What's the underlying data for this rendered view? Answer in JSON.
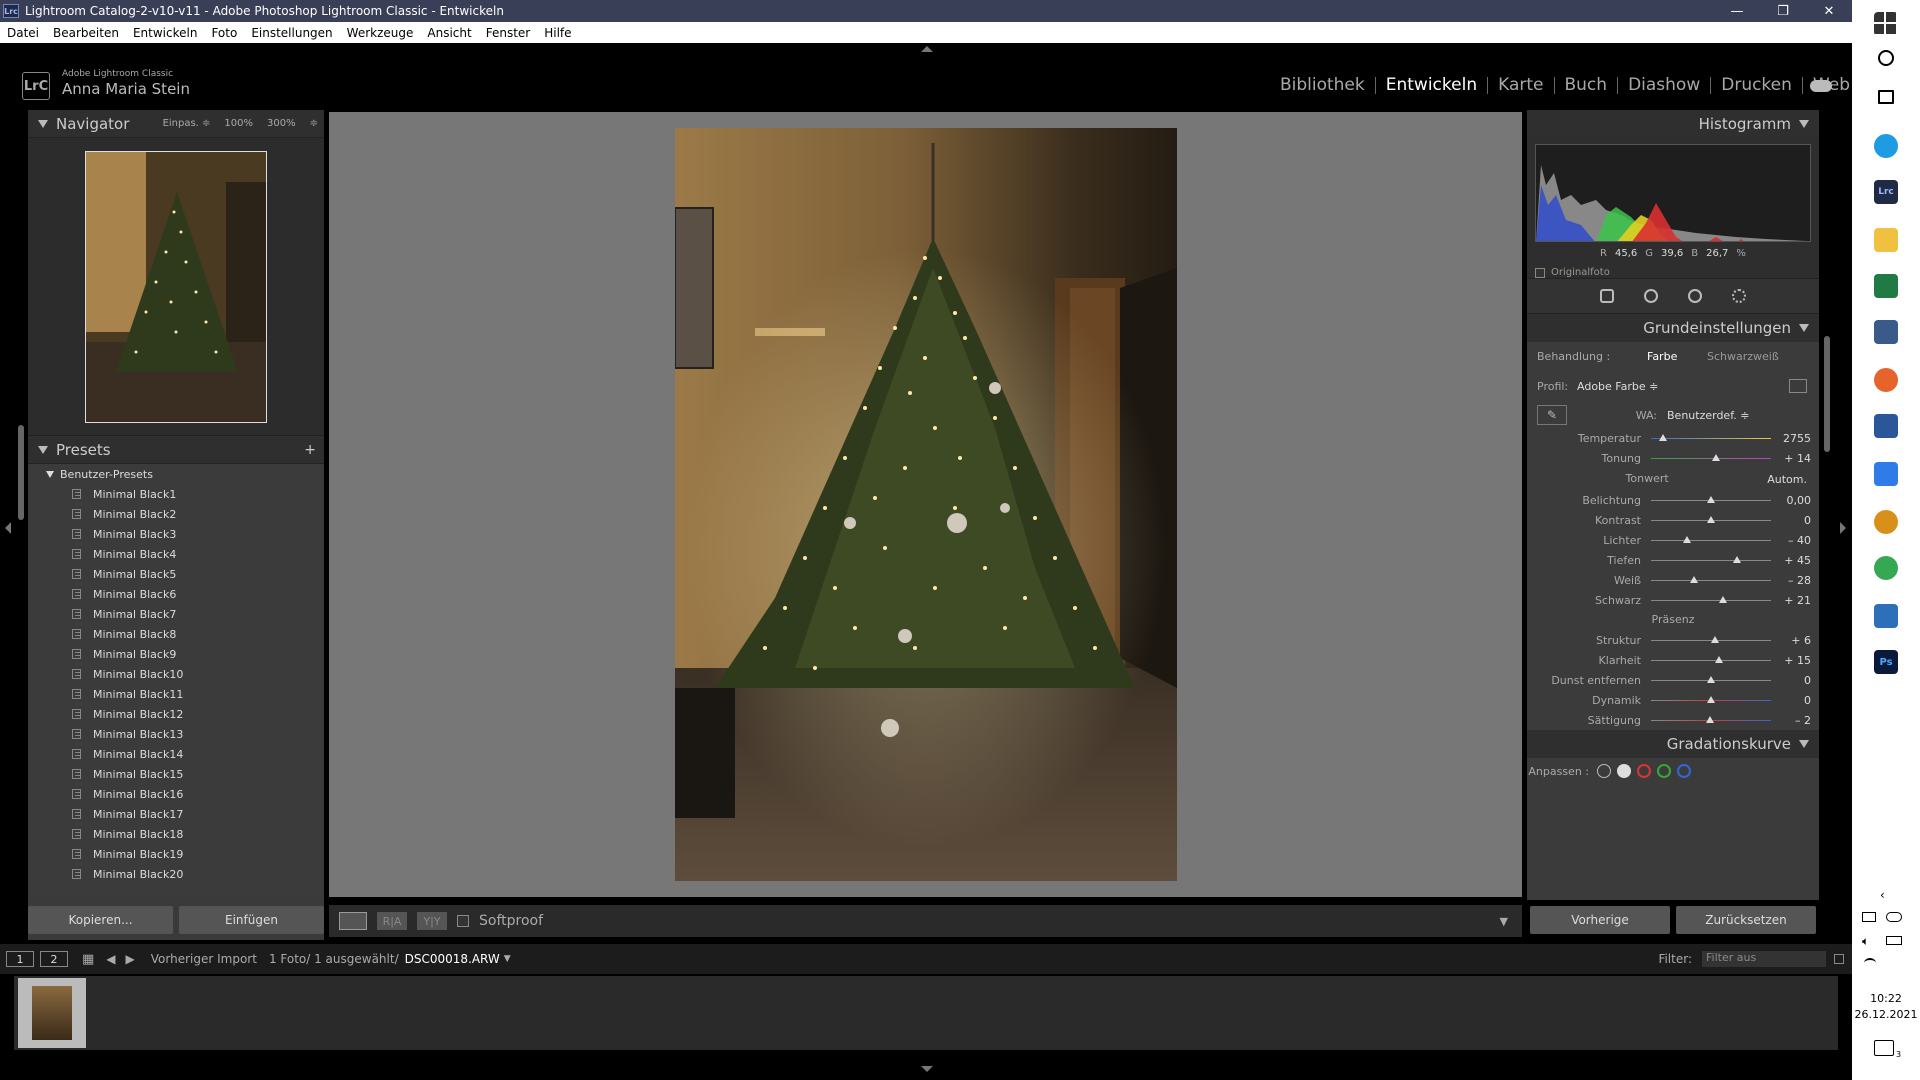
{
  "window": {
    "title": "Lightroom Catalog-2-v10-v11 - Adobe Photoshop Lightroom Classic - Entwickeln",
    "app_icon": "Lrc"
  },
  "menu": [
    "Datei",
    "Bearbeiten",
    "Entwickeln",
    "Foto",
    "Einstellungen",
    "Werkzeuge",
    "Ansicht",
    "Fenster",
    "Hilfe"
  ],
  "identity": {
    "logo": "LrC",
    "product": "Adobe Lightroom Classic",
    "user": "Anna Maria Stein"
  },
  "modules": [
    "Bibliothek",
    "Entwickeln",
    "Karte",
    "Buch",
    "Diashow",
    "Drucken",
    "Web"
  ],
  "navigator": {
    "title": "Navigator",
    "zoom": [
      "Einpas. ≑",
      "100%",
      "300%",
      "≑"
    ]
  },
  "presets": {
    "title": "Presets",
    "folder": "Benutzer-Presets",
    "items": [
      "Minimal Black1",
      "Minimal Black2",
      "Minimal Black3",
      "Minimal Black4",
      "Minimal Black5",
      "Minimal Black6",
      "Minimal Black7",
      "Minimal Black8",
      "Minimal Black9",
      "Minimal Black10",
      "Minimal Black11",
      "Minimal Black12",
      "Minimal Black13",
      "Minimal Black14",
      "Minimal Black15",
      "Minimal Black16",
      "Minimal Black17",
      "Minimal Black18",
      "Minimal Black19",
      "Minimal Black20"
    ]
  },
  "left_buttons": {
    "copy": "Kopieren...",
    "paste": "Einfügen"
  },
  "toolbar": {
    "softproof": "Softproof",
    "before_after": "R|A",
    "yy": "Y|Y"
  },
  "histogram": {
    "title": "Histogramm",
    "r_label": "R",
    "r": "45,6",
    "g_label": "G",
    "g": "39,6",
    "b_label": "B",
    "b": "26,7",
    "unit": "%",
    "original": "Originalfoto"
  },
  "basic": {
    "title": "Grundeinstellungen",
    "behandlung": "Behandlung :",
    "farbe": "Farbe",
    "sw": "Schwarzweiß",
    "profil_label": "Profil:",
    "profil": "Adobe Farbe ≑",
    "wa_label": "WA:",
    "wa": "Benutzerdef. ≑",
    "tonwert": "Tonwert",
    "autom": "Autom.",
    "praesenz": "Präsenz",
    "sliders": [
      {
        "label": "Temperatur",
        "value": "2755",
        "pos": 0.1
      },
      {
        "label": "Tonung",
        "value": "+ 14",
        "pos": 0.54
      },
      {
        "label": "Belichtung",
        "value": "0,00",
        "pos": 0.5
      },
      {
        "label": "Kontrast",
        "value": "0",
        "pos": 0.5
      },
      {
        "label": "Lichter",
        "value": "– 40",
        "pos": 0.3
      },
      {
        "label": "Tiefen",
        "value": "+ 45",
        "pos": 0.72
      },
      {
        "label": "Weiß",
        "value": "– 28",
        "pos": 0.36
      },
      {
        "label": "Schwarz",
        "value": "+ 21",
        "pos": 0.6
      },
      {
        "label": "Struktur",
        "value": "+ 6",
        "pos": 0.53
      },
      {
        "label": "Klarheit",
        "value": "+ 15",
        "pos": 0.57
      },
      {
        "label": "Dunst entfernen",
        "value": "0",
        "pos": 0.5
      },
      {
        "label": "Dynamik",
        "value": "0",
        "pos": 0.5
      },
      {
        "label": "Sättigung",
        "value": "– 2",
        "pos": 0.49
      }
    ]
  },
  "curve": {
    "title": "Gradationskurve",
    "anpassen": "Anpassen :"
  },
  "right_buttons": {
    "prev": "Vorherige",
    "reset": "Zurücksetzen"
  },
  "filmbar": {
    "page1": "1",
    "page2": "2",
    "source": "Vorheriger Import",
    "count": "1 Foto/ 1 ausgewählt/",
    "file": "DSC00018.ARW",
    "filter_label": "Filter:",
    "filter": "Filter aus"
  },
  "thumb_index": "1",
  "clock": {
    "time": "10:22",
    "date": "26.12.2021"
  },
  "notification_count": "3"
}
